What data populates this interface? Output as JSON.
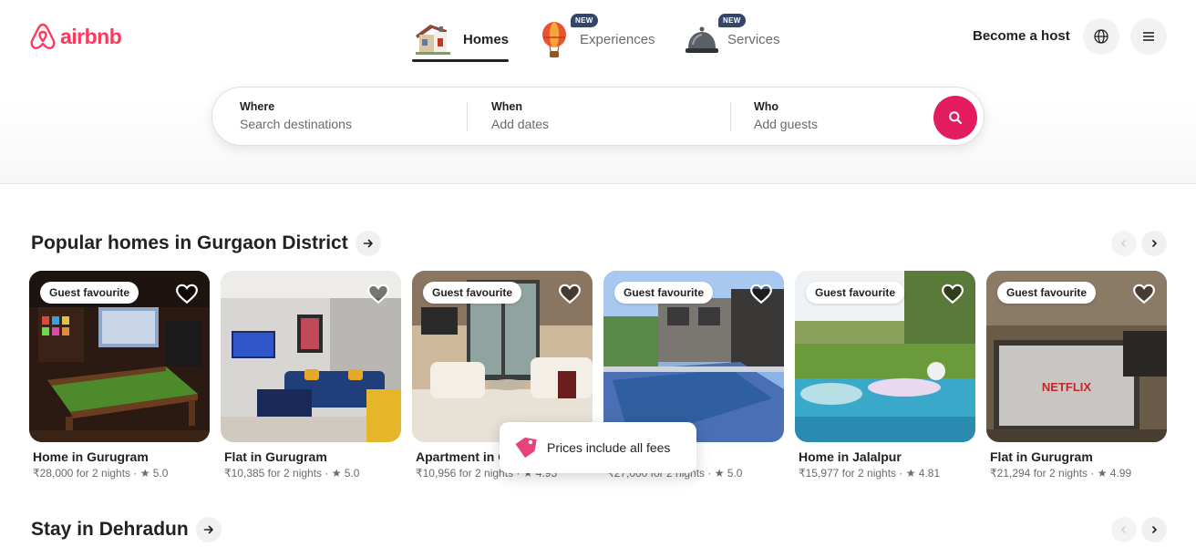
{
  "brand": {
    "name": "airbnb",
    "color": "#ff385c"
  },
  "nav": {
    "tabs": [
      {
        "label": "Homes",
        "icon": "house-icon",
        "active": true
      },
      {
        "label": "Experiences",
        "icon": "hot-air-balloon-icon",
        "badge": "NEW"
      },
      {
        "label": "Services",
        "icon": "service-bell-icon",
        "badge": "NEW"
      }
    ],
    "host_link": "Become a host",
    "globe_icon": "globe-icon",
    "menu_icon": "menu-icon"
  },
  "search": {
    "where": {
      "title": "Where",
      "placeholder": "Search destinations"
    },
    "when": {
      "title": "When",
      "placeholder": "Add dates"
    },
    "who": {
      "title": "Who",
      "placeholder": "Add guests"
    },
    "button_icon": "search-icon",
    "accent": "#e31c5f"
  },
  "sections": [
    {
      "title": "Popular homes in Gurgaon District",
      "listings": [
        {
          "badge": "Guest favourite",
          "title": "Home in Gurugram",
          "meta": "₹28,000 for 2 nights · ★ 5.0"
        },
        {
          "badge": "",
          "title": "Flat in Gurugram",
          "meta": "₹10,385 for 2 nights · ★ 5.0"
        },
        {
          "badge": "Guest favourite",
          "title": "Apartment in G",
          "meta": "₹10,956 for 2 nights · ★ 4.93"
        },
        {
          "badge": "Guest favourite",
          "title": "",
          "meta": "₹27,000 for 2 nights · ★ 5.0"
        },
        {
          "badge": "Guest favourite",
          "title": "Home in Jalalpur",
          "meta": "₹15,977 for 2 nights · ★ 4.81"
        },
        {
          "badge": "Guest favourite",
          "title": "Flat in Gurugram",
          "meta": "₹21,294 for 2 nights · ★ 4.99"
        }
      ]
    },
    {
      "title": "Stay in Dehradun"
    }
  ],
  "toast": {
    "text": "Prices include all fees",
    "icon": "price-tag-icon"
  },
  "image_text": {
    "tv_screen": "NETFLIX"
  }
}
